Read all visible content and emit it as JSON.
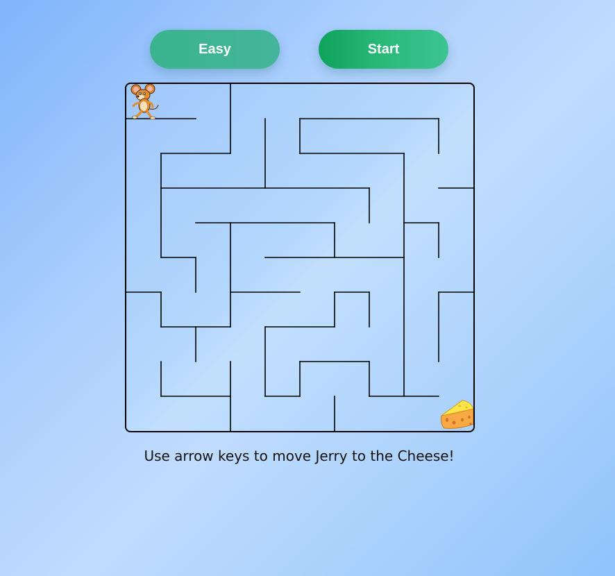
{
  "controls": {
    "difficulty_label": "Easy",
    "start_label": "Start"
  },
  "instructions": "Use arrow keys to move Jerry to the Cheese!",
  "maze": {
    "player_icon": "jerry-mouse-icon",
    "goal_icon": "cheese-icon",
    "colors": {
      "wall": "#000000",
      "easy_button": "#3fb593",
      "start_button": "#17a865"
    }
  }
}
